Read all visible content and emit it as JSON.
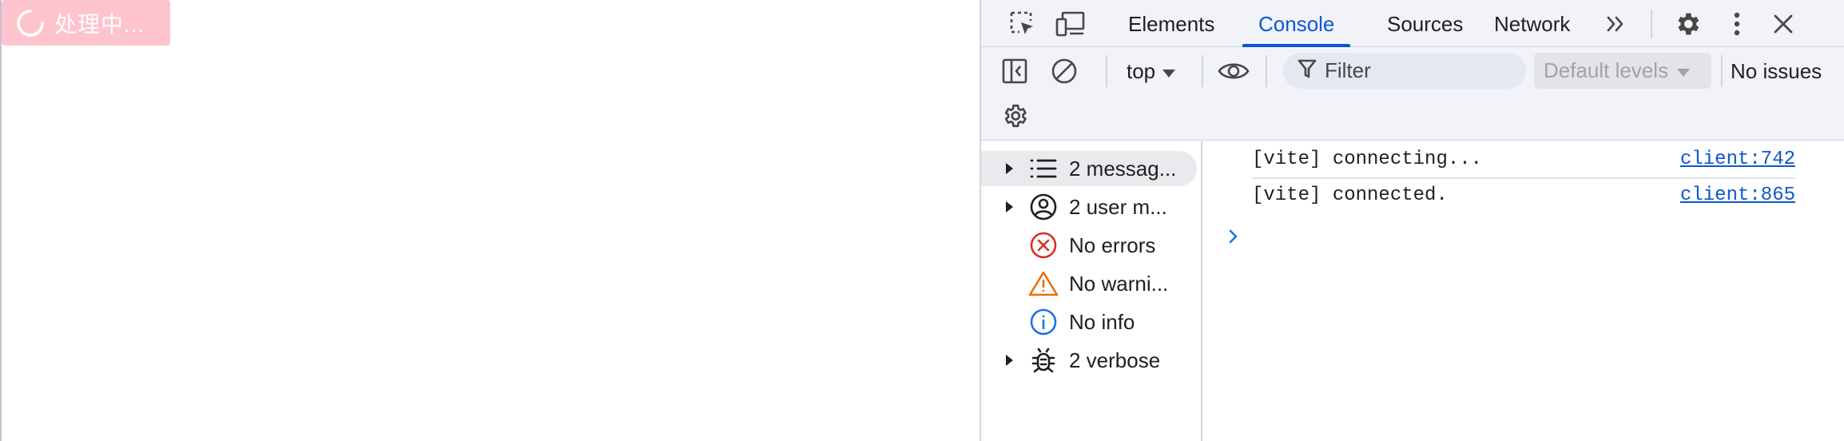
{
  "viewport": {
    "loading_button_label": "处理中..."
  },
  "devtools": {
    "tabs": [
      {
        "label": "Elements",
        "active": false
      },
      {
        "label": "Console",
        "active": true
      },
      {
        "label": "Sources",
        "active": false
      },
      {
        "label": "Network",
        "active": false
      }
    ],
    "toolbar": {
      "context": "top",
      "filter_placeholder": "Filter",
      "levels": "Default levels",
      "issues": "No issues"
    },
    "sidebar": {
      "items": [
        {
          "label": "2 messag...",
          "icon": "list-icon",
          "expandable": true,
          "selected": true
        },
        {
          "label": "2 user m...",
          "icon": "user-icon",
          "expandable": true,
          "selected": false
        },
        {
          "label": "No errors",
          "icon": "error-icon",
          "expandable": false,
          "selected": false
        },
        {
          "label": "No warni...",
          "icon": "warning-icon",
          "expandable": false,
          "selected": false
        },
        {
          "label": "No info",
          "icon": "info-icon",
          "expandable": false,
          "selected": false
        },
        {
          "label": "2 verbose",
          "icon": "bug-icon",
          "expandable": true,
          "selected": false
        }
      ]
    },
    "messages": [
      {
        "text": "[vite] connecting...",
        "source": "client:742"
      },
      {
        "text": "[vite] connected.",
        "source": "client:865"
      }
    ]
  },
  "colors": {
    "accent": "#0b57d0",
    "loading_button_bg": "#fec4ce",
    "error": "#d93025",
    "warning": "#e8710a",
    "info": "#1a73e8"
  }
}
